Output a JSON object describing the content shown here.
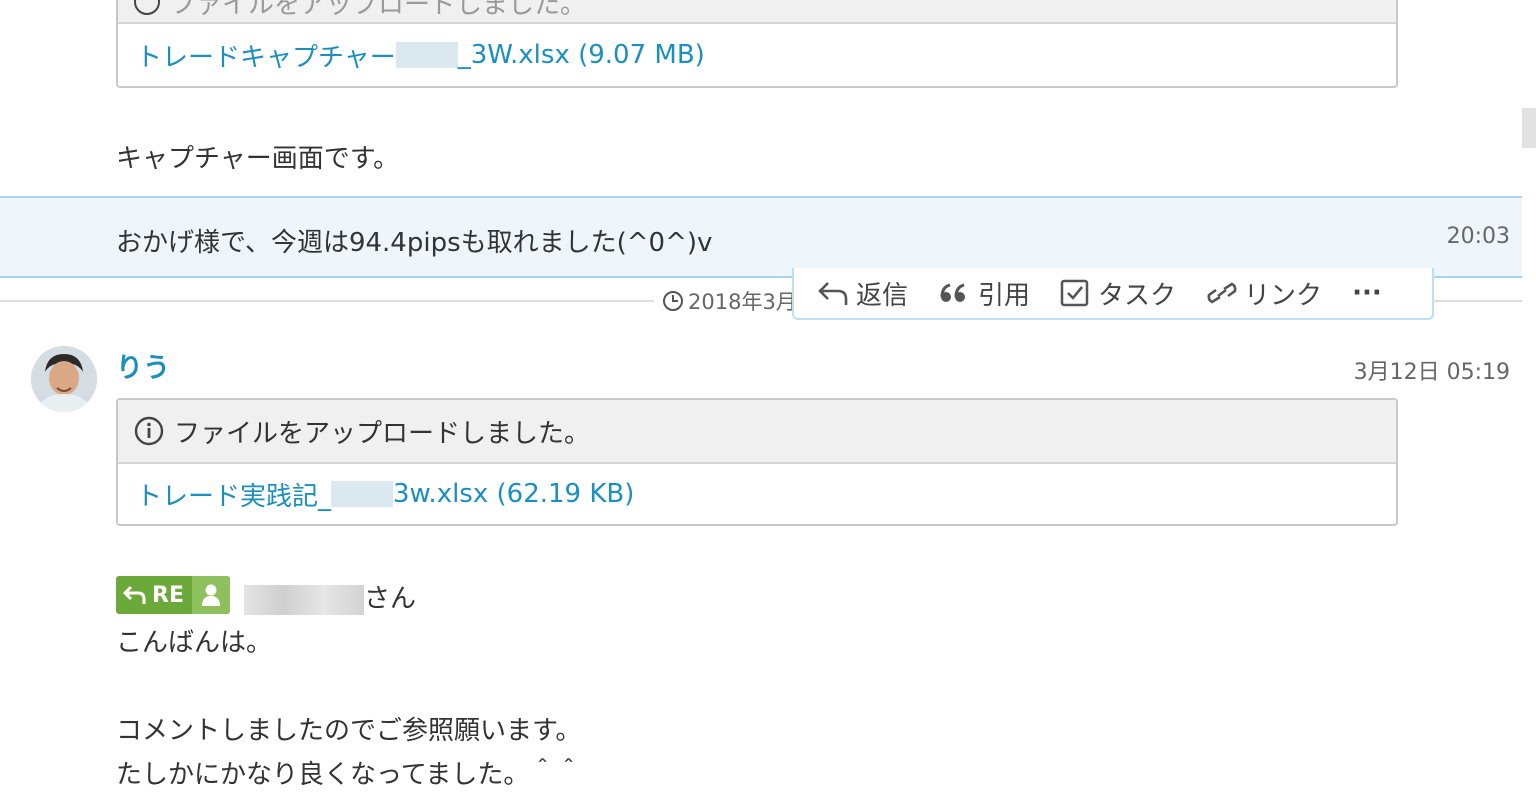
{
  "top_message": {
    "file_header": "ファイルをアップロードしました。",
    "file_link_prefix": "トレードキャプチャー",
    "file_link_suffix": "_3W.xlsx (9.07 MB)",
    "text": "キャプチャー画面です。"
  },
  "highlighted_message": {
    "text": "おかげ様で、今週は94.4pipsも取れました(^0^)v",
    "time": "20:03"
  },
  "toolbar": {
    "reply_label": "返信",
    "quote_label": "引用",
    "task_label": "タスク",
    "link_label": "リンク",
    "more_label": "···"
  },
  "date_separator": "2018年3月",
  "second_message": {
    "author": "りう",
    "time": "3月12日 05:19",
    "file_header": "ファイルをアップロードしました。",
    "file_link_prefix": "トレード実践記_",
    "file_link_suffix": "3w.xlsx (62.19 KB)",
    "re_label": "RE",
    "recipient_suffix": "さん",
    "lines": [
      "こんばんは。",
      "",
      "コメントしましたのでご参照願います。",
      "たしかにかなり良くなってました。＾＾"
    ]
  },
  "colors": {
    "link": "#1a8fc0",
    "highlight_bg": "#eef6fc",
    "highlight_border": "#a9d3ee",
    "re_badge": "#6aa93a"
  }
}
